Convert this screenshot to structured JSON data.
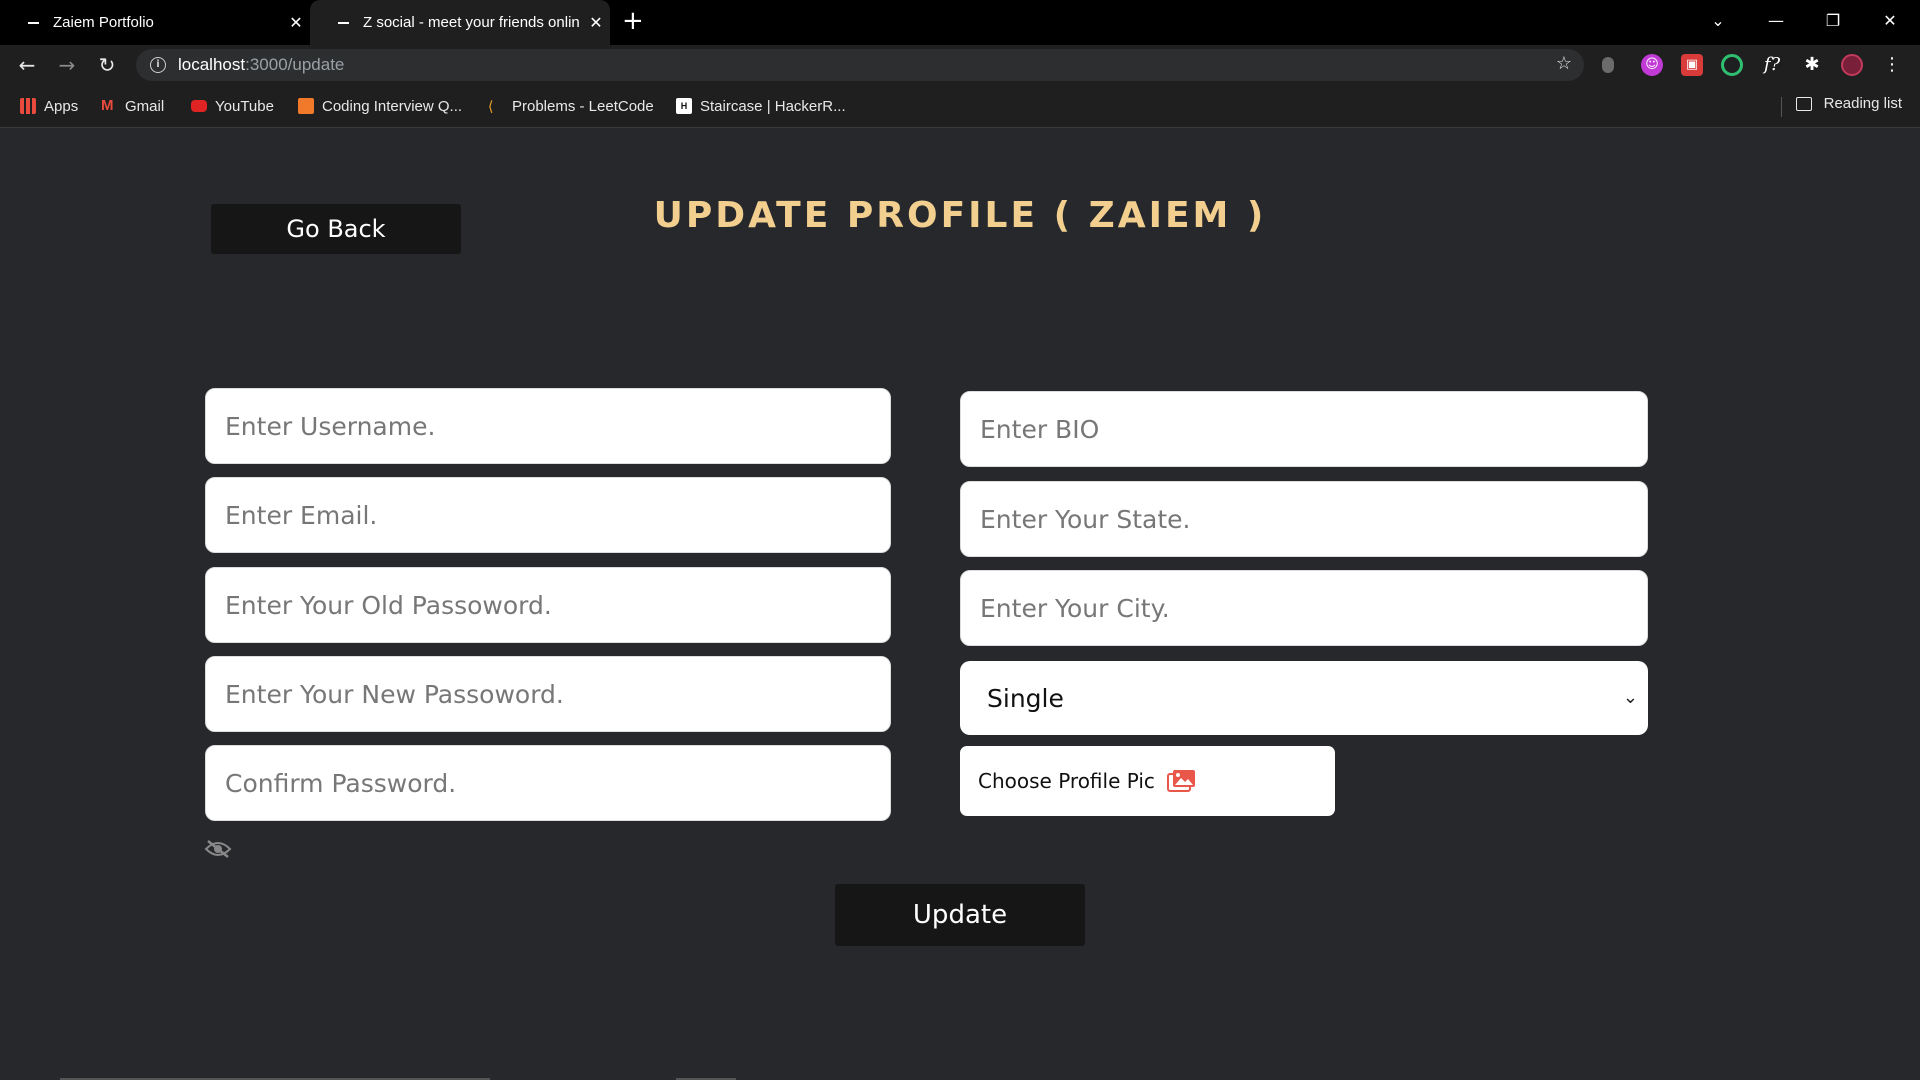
{
  "browser": {
    "tabs": [
      {
        "title": "Zaiem Portfolio"
      },
      {
        "title": "Z social - meet your friends onlin"
      }
    ],
    "url_host": "localhost",
    "url_path": ":3000/update",
    "bookmarks": [
      {
        "label": "Apps"
      },
      {
        "label": "Gmail"
      },
      {
        "label": "YouTube"
      },
      {
        "label": "Coding Interview Q..."
      },
      {
        "label": "Problems - LeetCode"
      },
      {
        "label": "Staircase | HackerR..."
      }
    ],
    "reading_list": "Reading list"
  },
  "page": {
    "go_back": "Go Back",
    "title": "UPDATE PROFILE ( ZAIEM )",
    "left_fields": {
      "username": "Enter Username.",
      "email": "Enter Email.",
      "old_password": "Enter Your Old Passoword.",
      "new_password": "Enter Your New Passoword.",
      "confirm_password": "Confirm Password."
    },
    "right_fields": {
      "bio": "Enter BIO",
      "state": "Enter Your State.",
      "city": "Enter Your City."
    },
    "relationship_select": "Single",
    "profile_pic_label": "Choose Profile Pic",
    "update_button": "Update"
  },
  "colors": {
    "title": "#f2cf8f",
    "background": "#26282c",
    "button_bg": "#161616",
    "pic_icon": "#e8574a"
  }
}
